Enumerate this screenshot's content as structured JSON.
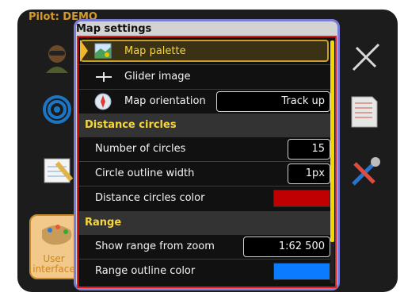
{
  "background": {
    "pilot_label": "Pilot: DEMO",
    "user_interface_label": "User\ninterface"
  },
  "dialog": {
    "title": "Map settings",
    "selected_row": "Map palette",
    "rows": [
      {
        "label": "Map palette",
        "icon": "map-palette-icon"
      },
      {
        "label": "Glider image",
        "icon": "glider-icon"
      },
      {
        "label": "Map orientation",
        "icon": "compass-icon",
        "value": "Track up"
      }
    ],
    "sections": [
      {
        "title": "Distance circles",
        "items": [
          {
            "label": "Number of circles",
            "value": "15"
          },
          {
            "label": "Circle outline width",
            "value": "1px"
          },
          {
            "label": "Distance circles color",
            "color": "#c00000"
          }
        ]
      },
      {
        "title": "Range",
        "items": [
          {
            "label": "Show range from zoom",
            "value": "1:62 500"
          },
          {
            "label": "Range outline color",
            "color": "#0a7cff"
          }
        ]
      }
    ],
    "scrollbar": {
      "visible_fraction": 0.83
    }
  }
}
